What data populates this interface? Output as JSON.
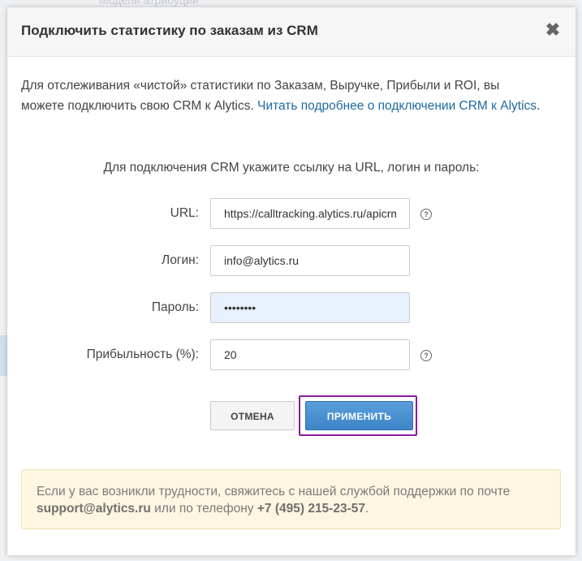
{
  "background": {
    "peek_text": "Модели атрибуции"
  },
  "dialog": {
    "title": "Подключить статистику по заказам из CRM",
    "close_icon": "close-icon"
  },
  "intro": {
    "text": "Для отслеживания «чистой» статистики по Заказам, Выручке, Прибыли и ROI, вы можете подключить свою CRM к Alytics. ",
    "link": "Читать подробнее о подключении CRM к Alytics",
    "end": "."
  },
  "instruction": "Для подключения CRM укажите ссылку на URL, логин и пароль:",
  "form": {
    "url": {
      "label": "URL:",
      "value": "https://calltracking.alytics.ru/apicrm/api"
    },
    "login": {
      "label": "Логин:",
      "value": "info@alytics.ru"
    },
    "password": {
      "label": "Пароль:",
      "value": "password"
    },
    "profit": {
      "label": "Прибыльность (%):",
      "value": "20"
    },
    "help_icon": "?"
  },
  "buttons": {
    "cancel": "ОТМЕНА",
    "apply": "ПРИМЕНИТЬ"
  },
  "notice": {
    "text1": "Если у вас возникли трудности, свяжитесь с нашей службой поддержки по почте ",
    "email": "support@alytics.ru",
    "text2": " или по телефону ",
    "phone": "+7 (495) 215-23-57",
    "end": "."
  }
}
